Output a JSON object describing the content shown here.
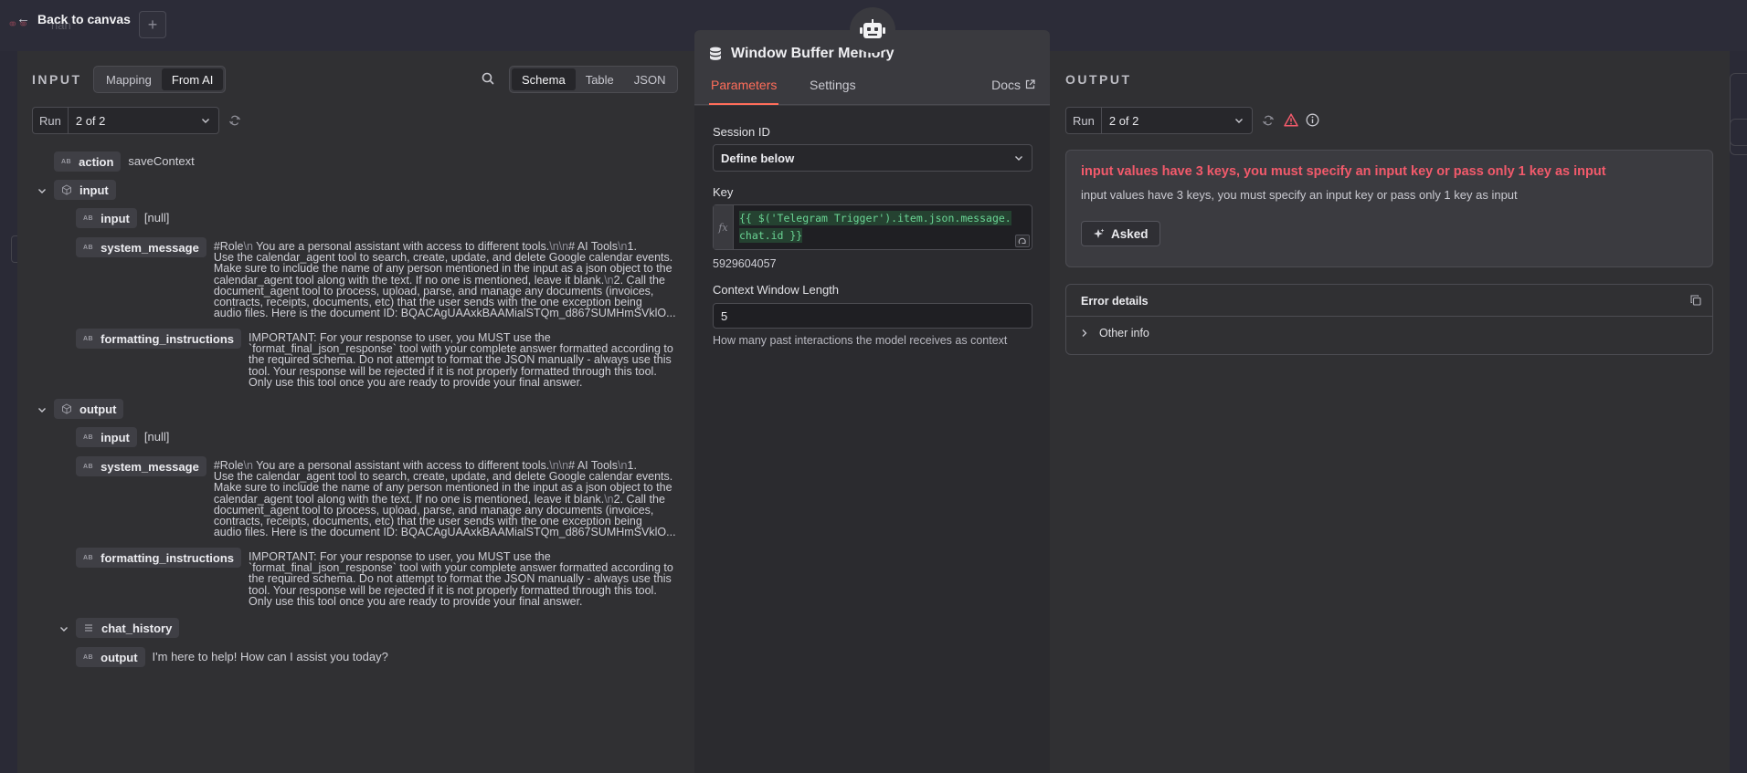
{
  "topbar": {
    "back_label": "Back to canvas",
    "back_arrow": "←",
    "plus": "+",
    "ghost_text": "han"
  },
  "input_panel": {
    "title": "INPUT",
    "mode_tabs": [
      "Mapping",
      "From AI"
    ],
    "view_tabs": [
      "Schema",
      "Table",
      "JSON"
    ],
    "run_label": "Run",
    "run_value": "2 of 2",
    "type_badge": "AB",
    "tree": {
      "action_key": "action",
      "action_val": "saveContext",
      "input_group": "input",
      "output_group": "output",
      "input_key": "input",
      "input_val": "[null]",
      "system_message_key": "system_message",
      "system_message_lines": [
        [
          "#Role",
          "\\n",
          " You are a personal assistant with access to different tools.",
          "\\n\\n",
          "# AI Tools",
          "\\n",
          "1."
        ],
        [
          "Use the calendar_agent tool to search, create, update, and delete Google calendar events."
        ],
        [
          "Make sure to include the name of any person mentioned in the input as a json object to the"
        ],
        [
          "calendar_agent tool along with the text. If no one is mentioned, leave it blank.",
          "\\n",
          "2. Call the"
        ],
        [
          "document_agent tool to process, upload, parse, and manage any documents (invoices,"
        ],
        [
          "contracts, receipts, documents, etc) that the user sends with the one exception being"
        ],
        [
          "audio files. Here is the document ID: BQACAgUAAxkBAAMialSTQm_d867SUMHmSVklO..."
        ]
      ],
      "formatting_key": "formatting_instructions",
      "formatting_lines": [
        "IMPORTANT: For your response to user, you MUST use the",
        "`format_final_json_response` tool with your complete answer formatted according to",
        "the required schema. Do not attempt to format the JSON manually - always use this",
        "tool. Your response will be rejected if it is not properly formatted through this tool.",
        "Only use this tool once you are ready to provide your final answer."
      ],
      "chat_history_key": "chat_history",
      "chat_output_key": "output",
      "chat_output_val": "I'm here to help! How can I assist you today?"
    }
  },
  "node": {
    "title": "Window Buffer Memory",
    "tabs": [
      "Parameters",
      "Settings"
    ],
    "docs": "Docs",
    "session_id_label": "Session ID",
    "session_id_value": "Define below",
    "key_label": "Key",
    "key_fx": "fx",
    "key_expr_line1": "{{ $('Telegram Trigger').item.json.message.",
    "key_expr_line2": "chat.id }}",
    "key_result": "5929604057",
    "context_label": "Context Window Length",
    "context_value": "5",
    "context_hint": "How many past interactions the model receives as context"
  },
  "output_panel": {
    "title": "OUTPUT",
    "run_label": "Run",
    "run_value": "2 of 2",
    "error_title": "input values have 3 keys, you must specify an input key or pass only 1 key as input",
    "error_sub": "input values have 3 keys, you must specify an input key or pass only 1 key as input",
    "asked_label": "Asked",
    "details_title": "Error details",
    "other_info": "Other info"
  },
  "colors": {
    "accent": "#ff6d5a",
    "error": "#f25a6b",
    "expr_green": "#6ad494"
  }
}
